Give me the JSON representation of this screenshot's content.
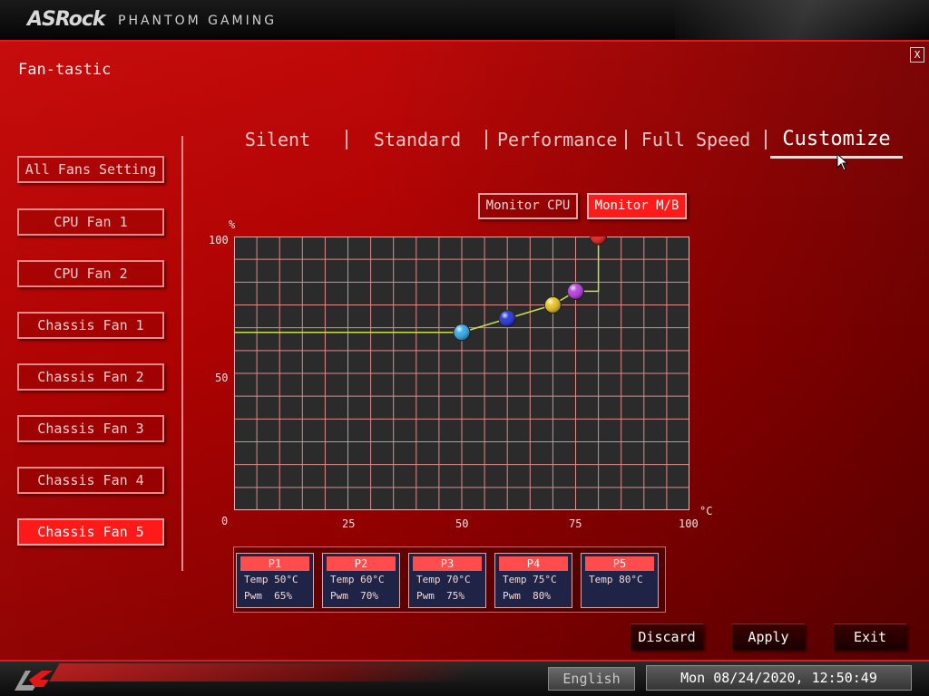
{
  "header": {
    "brand": "ASRock",
    "subtitle": "PHANTOM GAMING"
  },
  "page": {
    "title": "Fan-tastic",
    "close_label": "X"
  },
  "sidebar": {
    "items": [
      {
        "label": "All Fans Setting",
        "active": false
      },
      {
        "label": "CPU Fan 1",
        "active": false
      },
      {
        "label": "CPU Fan 2",
        "active": false
      },
      {
        "label": "Chassis Fan 1",
        "active": false
      },
      {
        "label": "Chassis Fan 2",
        "active": false
      },
      {
        "label": "Chassis Fan 3",
        "active": false
      },
      {
        "label": "Chassis Fan 4",
        "active": false
      },
      {
        "label": "Chassis Fan 5",
        "active": true
      }
    ]
  },
  "tabs": [
    {
      "label": "Silent",
      "active": false
    },
    {
      "label": "Standard",
      "active": false
    },
    {
      "label": "Performance",
      "active": false
    },
    {
      "label": "Full Speed",
      "active": false
    },
    {
      "label": "Customize",
      "active": true
    }
  ],
  "monitor": {
    "cpu_label": "Monitor CPU",
    "mb_label": "Monitor M/B",
    "selected": "mb"
  },
  "chart_data": {
    "type": "line",
    "x_range": [
      0,
      100
    ],
    "y_range": [
      0,
      100
    ],
    "x_ticks": [
      "0",
      "25",
      "50",
      "75",
      "100"
    ],
    "y_ticks": [
      "0",
      "50",
      "100"
    ],
    "x_unit": "°C",
    "y_unit": "%",
    "grid": true,
    "points": [
      {
        "name": "P1",
        "temp": 50,
        "pwm": 65,
        "color": "#2aa7e8"
      },
      {
        "name": "P2",
        "temp": 60,
        "pwm": 70,
        "color": "#1a2ad8"
      },
      {
        "name": "P3",
        "temp": 70,
        "pwm": 75,
        "color": "#e8c21a"
      },
      {
        "name": "P4",
        "temp": 75,
        "pwm": 80,
        "color": "#b436e0"
      },
      {
        "name": "P5",
        "temp": 80,
        "pwm": 100,
        "color": "#e01818"
      }
    ]
  },
  "point_table": [
    {
      "name": "P1",
      "temp": "Temp 50°C",
      "pwm": "Pwm  65%"
    },
    {
      "name": "P2",
      "temp": "Temp 60°C",
      "pwm": "Pwm  70%"
    },
    {
      "name": "P3",
      "temp": "Temp 70°C",
      "pwm": "Pwm  75%"
    },
    {
      "name": "P4",
      "temp": "Temp 75°C",
      "pwm": "Pwm  80%"
    },
    {
      "name": "P5",
      "temp": "Temp 80°C",
      "pwm": ""
    }
  ],
  "actions": {
    "discard": "Discard",
    "apply": "Apply",
    "exit": "Exit"
  },
  "footer": {
    "language": "English",
    "datetime": "Mon 08/24/2020, 12:50:49"
  },
  "colors": {
    "accent": "#ff1a1a",
    "curve": "#c8e04a",
    "grid": "#e08a8a"
  },
  "icons": {
    "close": "close-icon",
    "logo": "phantom-gaming-logo-icon",
    "cursor": "mouse-pointer-icon"
  }
}
